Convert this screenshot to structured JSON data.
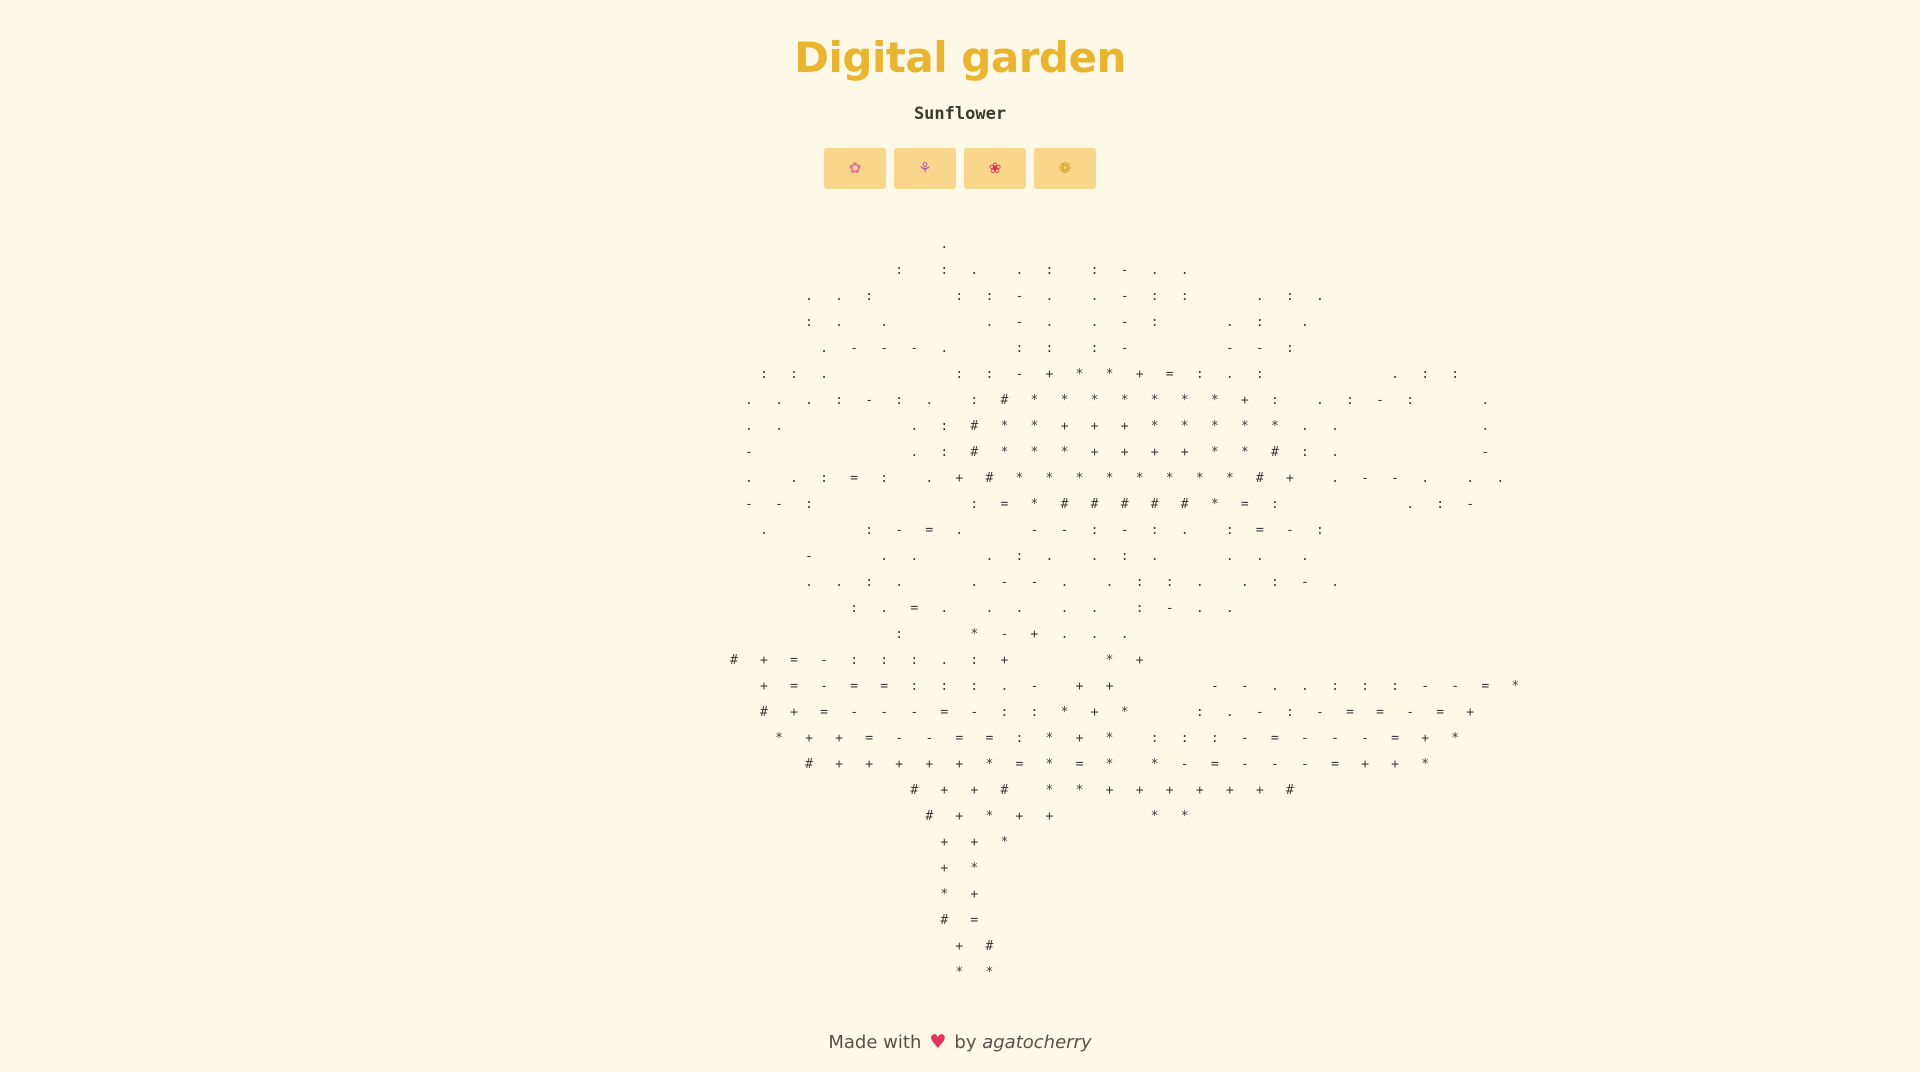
{
  "page": {
    "title": "Digital garden",
    "subtitle": "Sunflower"
  },
  "buttons": [
    {
      "name": "cherry-blossom",
      "glyph": "✿",
      "color": "#e8739a"
    },
    {
      "name": "tulip",
      "glyph": "⚘",
      "color": "#b25ab5"
    },
    {
      "name": "rose",
      "glyph": "❀",
      "color": "#d8354a"
    },
    {
      "name": "sunflower",
      "glyph": "❁",
      "color": "#d1a21d"
    }
  ],
  "art": {
    "lines": [
      "              .",
      "           :  : .  . :  : - . .",
      "     . . :     : : - .  . - : :    . : .",
      "     : .  .      . - .  . - :    . :  .",
      "      . - - - .    : :  : -      - - :",
      "  : : .        : : - + * * + = : . :        . : :",
      " . . . : - : .  : # * * * * * * * + :  . : - :    .",
      " . .        . : # * * + + + * * * * * . .         .",
      " -          . : # * * * + + + + * * # : .         -",
      " .  . : = :  . + # * * * * * * * * # +  . - - .  . .",
      " - - :          : = * # # # # # * = :        . : -",
      "  .      : - = .    - - : - : .  : = - :",
      "     -    . .    . : .  . : .    . .  .",
      "     . . : .    . - - .  . : : .  . : - .",
      "        : . = .  . .  . .  : - . .",
      "           :    * - + . . .",
      "# + = - : : : . : +      * +",
      "  + = - = = : : : . -  + +      - - . . : : : - - = *",
      "  # + = - - - = - : : * + *    : . - : - = = - = +",
      "   * + + = - - = = : * + *  : : : - = - - - = + *",
      "     # + + + + + * = * = *  * - = - - - = + + *",
      "            # + + #  * * + + + + + + #",
      "             # + * + +      * *",
      "              + + *",
      "              + *",
      "              * +",
      "              # =",
      "               + #",
      "               * *"
    ]
  },
  "footer": {
    "made_with": "Made with",
    "heart": "♥",
    "by": "by",
    "author": "agatocherry"
  }
}
